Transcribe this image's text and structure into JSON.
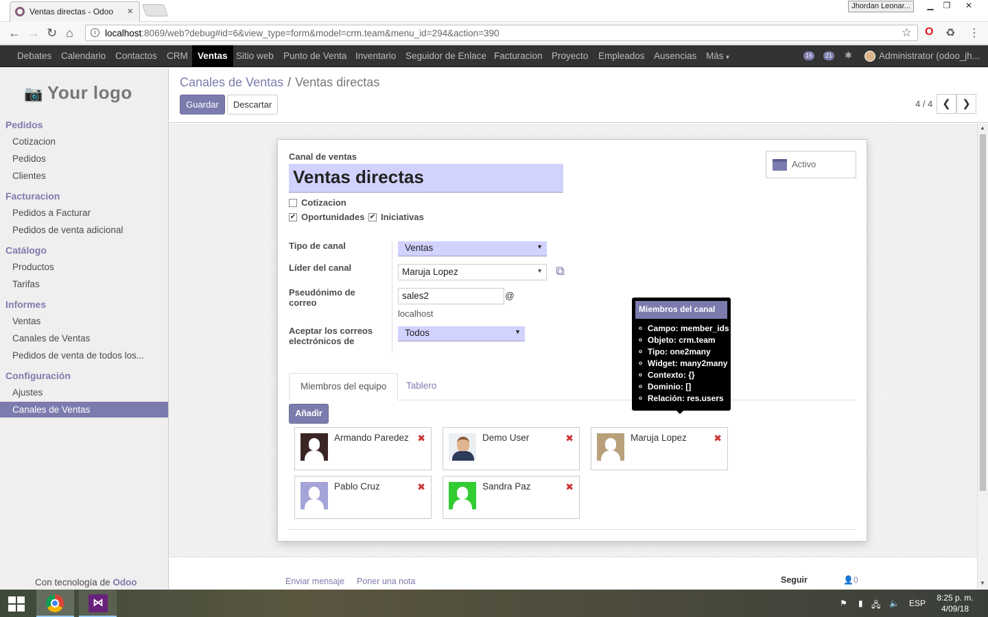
{
  "browser": {
    "tab_title": "Ventas directas - Odoo",
    "window_user": "Jhordan Leonar...",
    "url_host": "localhost",
    "url_rest": ":8069/web?debug#id=6&view_type=form&model=crm.team&menu_id=294&action=390"
  },
  "menubar": {
    "items": [
      "Debates",
      "Calendario",
      "Contactos",
      "CRM",
      "Ventas",
      "Sitio web",
      "Punto de Venta",
      "Inventario",
      "Seguidor de Enlace",
      "Facturacion",
      "Proyecto",
      "Empleados",
      "Ausencias",
      "Más"
    ],
    "active": "Ventas",
    "badge_messages": "16",
    "badge_activities": "21",
    "user": "Administrator (odoo_jh..."
  },
  "sidebar": {
    "logo": "Your logo",
    "sections": [
      {
        "title": "Pedidos",
        "items": [
          "Cotizacion",
          "Pedidos",
          "Clientes"
        ]
      },
      {
        "title": "Facturacion",
        "items": [
          "Pedidos a Facturar",
          "Pedidos de venta adicional"
        ]
      },
      {
        "title": "Catálogo",
        "items": [
          "Productos",
          "Tarifas"
        ]
      },
      {
        "title": "Informes",
        "items": [
          "Ventas",
          "Canales de Ventas",
          "Pedidos de venta de todos los..."
        ]
      },
      {
        "title": "Configuración",
        "items": [
          "Ajustes",
          "Canales de Ventas"
        ]
      }
    ],
    "powered_prefix": "Con tecnología de",
    "powered_brand": "Odoo"
  },
  "control_panel": {
    "breadcrumb_parent": "Canales de Ventas",
    "breadcrumb_sep": "/",
    "breadcrumb_current": "Ventas directas",
    "save": "Guardar",
    "discard": "Descartar",
    "pager": "4 / 4"
  },
  "form": {
    "name_label": "Canal de ventas",
    "name": "Ventas directas",
    "archive": "Activo",
    "checkboxes": [
      {
        "label": "Cotizacion",
        "checked": false
      },
      {
        "label": "Oportunidades",
        "checked": true
      },
      {
        "label": "Iniciativas",
        "checked": true
      }
    ],
    "type_label": "Tipo de canal",
    "type_value": "Ventas",
    "leader_label": "Líder del canal",
    "leader_value": "Maruja Lopez",
    "alias_label_1": "Pseudónimo de",
    "alias_label_2": "correo",
    "alias_value": "sales2",
    "alias_at": "@",
    "alias_domain": "localhost",
    "accept_label_1": "Aceptar los correos",
    "accept_label_2": "electrónicos de",
    "accept_value": "Todos"
  },
  "tooltip": {
    "title": "Miembros del canal",
    "lines": [
      "Campo: member_ids",
      "Objeto: crm.team",
      "Tipo: one2many",
      "Widget: many2many",
      "Contexto: {}",
      "Dominio: []",
      "Relación: res.users"
    ]
  },
  "tabs": [
    "Miembros del equipo",
    "Tablero"
  ],
  "add_button": "Añadir",
  "members": [
    {
      "name": "Armando Paredez",
      "bg": "#3b2424"
    },
    {
      "name": "Demo User",
      "bg": "#f0f0f0"
    },
    {
      "name": "Maruja Lopez",
      "bg": "#b8a17a"
    },
    {
      "name": "Pablo Cruz",
      "bg": "#a4a4d8"
    },
    {
      "name": "Sandra Paz",
      "bg": "#33cc33"
    }
  ],
  "chatter": {
    "send": "Enviar mensaje",
    "note": "Poner una nota",
    "follow": "Seguir",
    "followers": "0"
  },
  "taskbar": {
    "lang": "ESP",
    "time": "8:25 p. m.",
    "date": "4/09/18"
  },
  "colors": {
    "accent": "#7c7bad",
    "menubar": "#333333",
    "field_bg": "#d2d2ff"
  }
}
